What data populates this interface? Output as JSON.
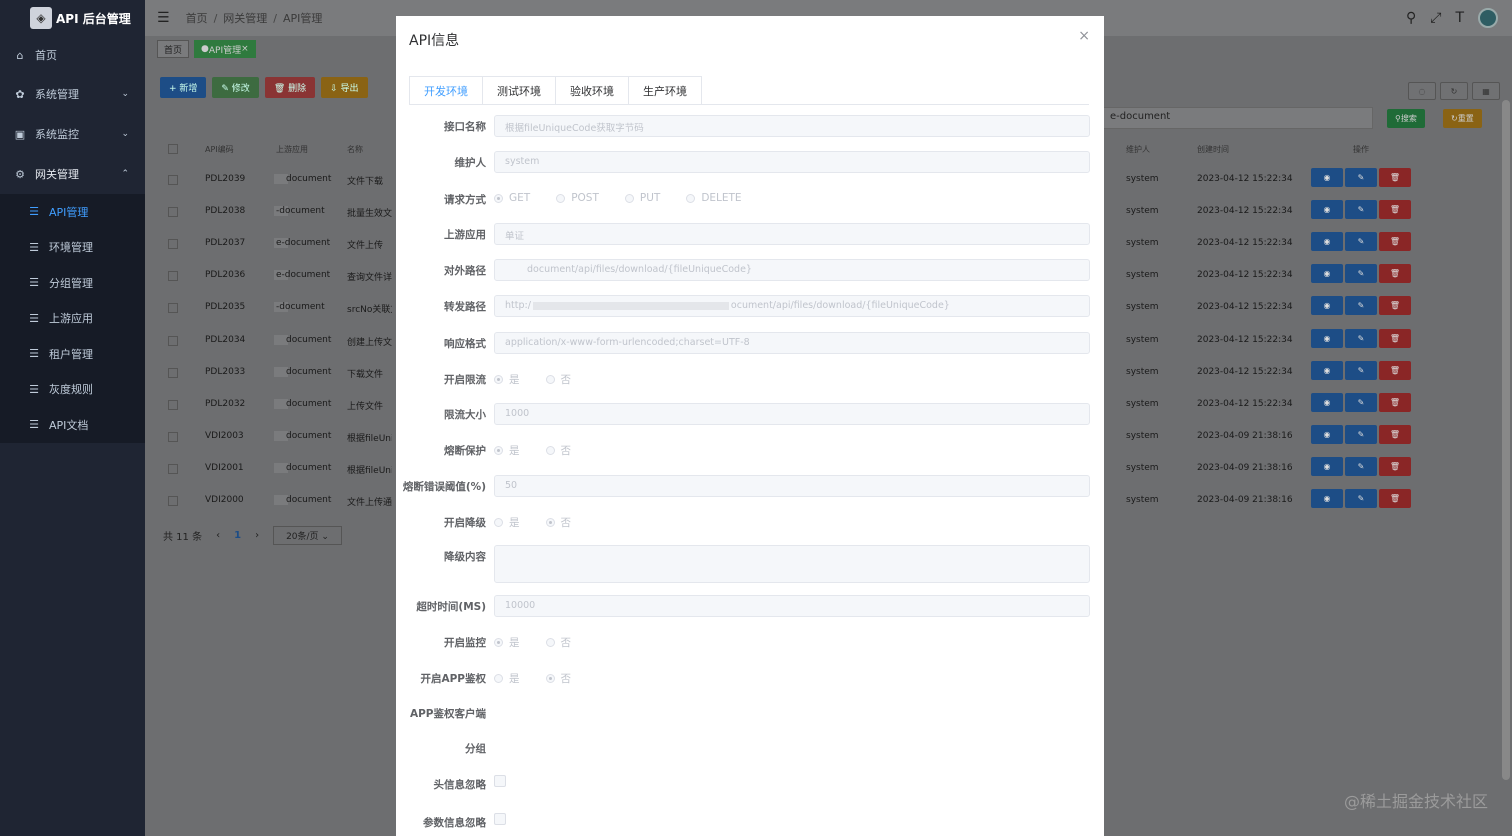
{
  "app": {
    "title": "API 后台管理",
    "logo_icon": "shield-logo-icon"
  },
  "sidebar": {
    "items": [
      {
        "label": "首页",
        "icon": "home-icon"
      },
      {
        "label": "系统管理",
        "icon": "gear-icon"
      },
      {
        "label": "系统监控",
        "icon": "monitor-icon"
      },
      {
        "label": "网关管理",
        "icon": "gateway-icon"
      }
    ],
    "sub_items": [
      {
        "label": "API管理",
        "active": true
      },
      {
        "label": "环境管理"
      },
      {
        "label": "分组管理"
      },
      {
        "label": "上游应用"
      },
      {
        "label": "租户管理"
      },
      {
        "label": "灰度规则"
      },
      {
        "label": "API文档"
      }
    ]
  },
  "breadcrumb": [
    "首页",
    "网关管理",
    "API管理"
  ],
  "tags_view": [
    "首页",
    "API管理"
  ],
  "toolbar": {
    "add": "+ 新增",
    "edit": "✎ 修改",
    "delete": "🗑 删除",
    "export": "⇩ 导出"
  },
  "search": {
    "value": "e-document",
    "search_btn": "搜索",
    "reset_btn": "重置"
  },
  "table": {
    "headers": [
      "API编码",
      "上游应用",
      "名称",
      "维护人",
      "创建时间",
      "操作"
    ],
    "rows": [
      {
        "code": "PDL2039",
        "app": "document",
        "name": "文件下载",
        "maintainer": "system",
        "created": "2023-04-12 15:22:34"
      },
      {
        "code": "PDL2038",
        "app": "-document",
        "name": "批量生效文件",
        "maintainer": "system",
        "created": "2023-04-12 15:22:34"
      },
      {
        "code": "PDL2037",
        "app": "e-document",
        "name": "文件上传",
        "maintainer": "system",
        "created": "2023-04-12 15:22:34"
      },
      {
        "code": "PDL2036",
        "app": "e-document",
        "name": "查询文件详情",
        "maintainer": "system",
        "created": "2023-04-12 15:22:34"
      },
      {
        "code": "PDL2035",
        "app": "-document",
        "name": "srcNo关联文件",
        "maintainer": "system",
        "created": "2023-04-12 15:22:34"
      },
      {
        "code": "PDL2034",
        "app": "document",
        "name": "创建上传文件",
        "maintainer": "system",
        "created": "2023-04-12 15:22:34"
      },
      {
        "code": "PDL2033",
        "app": "document",
        "name": "下载文件",
        "maintainer": "system",
        "created": "2023-04-12 15:22:34"
      },
      {
        "code": "PDL2032",
        "app": "document",
        "name": "上传文件",
        "maintainer": "system",
        "created": "2023-04-12 15:22:34"
      },
      {
        "code": "VDI2003",
        "app": "document",
        "name": "根据fileUnique",
        "maintainer": "system",
        "created": "2023-04-09 21:38:16"
      },
      {
        "code": "VDI2001",
        "app": "document",
        "name": "根据fileUnique",
        "maintainer": "system",
        "created": "2023-04-09 21:38:16"
      },
      {
        "code": "VDI2000",
        "app": "document",
        "name": "文件上传通用",
        "maintainer": "system",
        "created": "2023-04-09 21:38:16"
      }
    ]
  },
  "pager": {
    "total": "共 11 条",
    "page": "1",
    "size": "20条/页"
  },
  "modal": {
    "title": "API信息",
    "tabs": [
      "开发环境",
      "测试环境",
      "验收环境",
      "生产环境"
    ],
    "fields": {
      "name": {
        "label": "接口名称",
        "value": "根据fileUniqueCode获取字节码"
      },
      "maintainer": {
        "label": "维护人",
        "value": "system"
      },
      "method": {
        "label": "请求方式",
        "options": [
          "GET",
          "POST",
          "PUT",
          "DELETE"
        ]
      },
      "upstream": {
        "label": "上游应用",
        "value": "单证"
      },
      "external_path": {
        "label": "对外路径",
        "value": "document/api/files/download/{fileUniqueCode}"
      },
      "forward_path": {
        "label": "转发路径",
        "value_prefix": "http:/",
        "value_suffix": "ocument/api/files/download/{fileUniqueCode}"
      },
      "response_format": {
        "label": "响应格式",
        "value": "application/x-www-form-urlencoded;charset=UTF-8"
      },
      "rate_limit": {
        "label": "开启限流",
        "yes": "是",
        "no": "否"
      },
      "rate_size": {
        "label": "限流大小",
        "value": "1000"
      },
      "circuit": {
        "label": "熔断保护",
        "yes": "是",
        "no": "否"
      },
      "circuit_threshold": {
        "label": "熔断错误阈值(%)",
        "value": "50"
      },
      "degrade": {
        "label": "开启降级",
        "yes": "是",
        "no": "否"
      },
      "degrade_content": {
        "label": "降级内容",
        "value": ""
      },
      "timeout": {
        "label": "超时时间(MS)",
        "value": "10000"
      },
      "monitor": {
        "label": "开启监控",
        "yes": "是",
        "no": "否"
      },
      "app_auth": {
        "label": "开启APP鉴权",
        "yes": "是",
        "no": "否"
      },
      "app_auth_client": {
        "label": "APP鉴权客户端"
      },
      "group": {
        "label": "分组"
      },
      "header_ignore": {
        "label": "头信息忽略"
      },
      "param_ignore": {
        "label": "参数信息忽略"
      }
    }
  },
  "watermark": "@稀土掘金技术社区"
}
